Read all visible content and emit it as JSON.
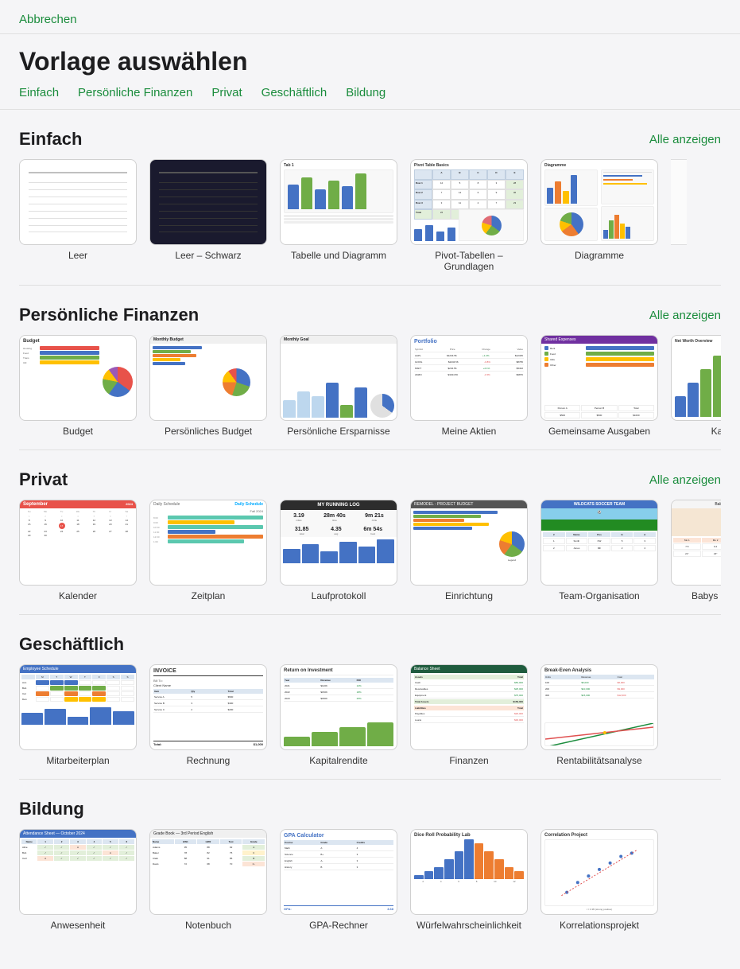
{
  "app": {
    "cancel_label": "Abbrechen",
    "page_title": "Vorlage auswählen"
  },
  "category_nav": {
    "items": [
      {
        "label": "Einfach",
        "id": "einfach"
      },
      {
        "label": "Persönliche Finanzen",
        "id": "persoenliche-finanzen"
      },
      {
        "label": "Privat",
        "id": "privat"
      },
      {
        "label": "Geschäftlich",
        "id": "geschaeftlich"
      },
      {
        "label": "Bildung",
        "id": "bildung"
      }
    ]
  },
  "sections": {
    "einfach": {
      "title": "Einfach",
      "show_all": "Alle anzeigen",
      "templates": [
        {
          "label": "Leer",
          "id": "leer"
        },
        {
          "label": "Leer – Schwarz",
          "id": "leer-schwarz"
        },
        {
          "label": "Tabelle und Diagramm",
          "id": "tabelle-diagramm"
        },
        {
          "label": "Pivot-Tabellen – Grundlagen",
          "id": "pivot-tabellen"
        },
        {
          "label": "Diagramme",
          "id": "diagramme"
        }
      ]
    },
    "persoenliche_finanzen": {
      "title": "Persönliche Finanzen",
      "show_all": "Alle anzeigen",
      "templates": [
        {
          "label": "Budget",
          "id": "budget"
        },
        {
          "label": "Persönliches Budget",
          "id": "persoenliches-budget"
        },
        {
          "label": "Persönliche Ersparnisse",
          "id": "persoenliche-ersparnisse"
        },
        {
          "label": "Meine Aktien",
          "id": "meine-aktien"
        },
        {
          "label": "Gemeinsame Ausgaben",
          "id": "gemeinsame-ausgaben"
        },
        {
          "label": "Kapital...",
          "id": "kapital"
        }
      ]
    },
    "privat": {
      "title": "Privat",
      "show_all": "Alle anzeigen",
      "templates": [
        {
          "label": "Kalender",
          "id": "kalender"
        },
        {
          "label": "Zeitplan",
          "id": "zeitplan"
        },
        {
          "label": "Laufprotokoll",
          "id": "laufprotokoll"
        },
        {
          "label": "Einrichtung",
          "id": "einrichtung"
        },
        {
          "label": "Team-Organisation",
          "id": "team-organisation"
        },
        {
          "label": "Babys erstes Jahr",
          "id": "babys-erstes-jahr"
        }
      ]
    },
    "geschaeftlich": {
      "title": "Geschäftlich",
      "show_all": null,
      "templates": [
        {
          "label": "Mitarbeiterplan",
          "id": "mitarbeiterplan"
        },
        {
          "label": "Rechnung",
          "id": "rechnung"
        },
        {
          "label": "Kapitalrendite",
          "id": "kapitalrendite"
        },
        {
          "label": "Finanzen",
          "id": "finanzen"
        },
        {
          "label": "Rentabilitätsanalyse",
          "id": "rentabilitaetsanalyse"
        }
      ]
    },
    "bildung": {
      "title": "Bildung",
      "show_all": null,
      "templates": [
        {
          "label": "Anwesenheit",
          "id": "anwesenheit"
        },
        {
          "label": "Notenbuch",
          "id": "notenbuch"
        },
        {
          "label": "GPA-Rechner",
          "id": "gpa-rechner"
        },
        {
          "label": "Würfelwahrscheinlichkeit",
          "id": "wuerfelwahrscheinlichkeit"
        },
        {
          "label": "Korrelationsprojekt",
          "id": "korrelationsprojekt"
        }
      ]
    }
  },
  "colors": {
    "accent": "#1a8c3c",
    "dark": "#1a1a2e",
    "budget_bars": [
      "#e8524a",
      "#4472c4",
      "#70ad47",
      "#ffc000"
    ],
    "calendar_red": "#e8524a",
    "daily_blue": "#00aaff",
    "daily_green": "#5bc8af"
  }
}
